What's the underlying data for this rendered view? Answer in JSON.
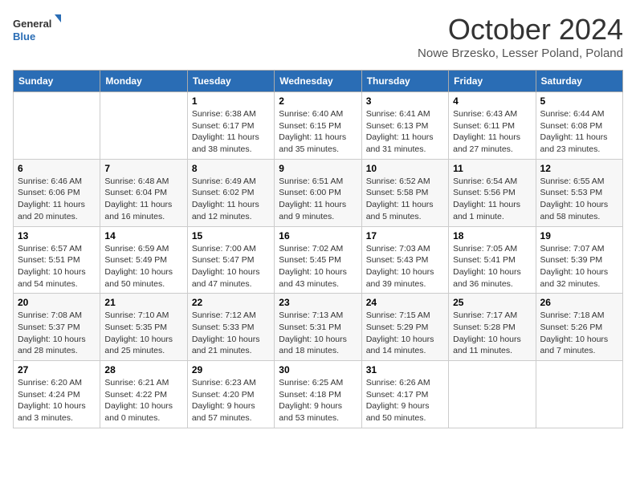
{
  "header": {
    "logo_general": "General",
    "logo_blue": "Blue",
    "month_title": "October 2024",
    "location": "Nowe Brzesko, Lesser Poland, Poland"
  },
  "weekdays": [
    "Sunday",
    "Monday",
    "Tuesday",
    "Wednesday",
    "Thursday",
    "Friday",
    "Saturday"
  ],
  "weeks": [
    [
      {
        "day": "",
        "info": ""
      },
      {
        "day": "",
        "info": ""
      },
      {
        "day": "1",
        "info": "Sunrise: 6:38 AM\nSunset: 6:17 PM\nDaylight: 11 hours and 38 minutes."
      },
      {
        "day": "2",
        "info": "Sunrise: 6:40 AM\nSunset: 6:15 PM\nDaylight: 11 hours and 35 minutes."
      },
      {
        "day": "3",
        "info": "Sunrise: 6:41 AM\nSunset: 6:13 PM\nDaylight: 11 hours and 31 minutes."
      },
      {
        "day": "4",
        "info": "Sunrise: 6:43 AM\nSunset: 6:11 PM\nDaylight: 11 hours and 27 minutes."
      },
      {
        "day": "5",
        "info": "Sunrise: 6:44 AM\nSunset: 6:08 PM\nDaylight: 11 hours and 23 minutes."
      }
    ],
    [
      {
        "day": "6",
        "info": "Sunrise: 6:46 AM\nSunset: 6:06 PM\nDaylight: 11 hours and 20 minutes."
      },
      {
        "day": "7",
        "info": "Sunrise: 6:48 AM\nSunset: 6:04 PM\nDaylight: 11 hours and 16 minutes."
      },
      {
        "day": "8",
        "info": "Sunrise: 6:49 AM\nSunset: 6:02 PM\nDaylight: 11 hours and 12 minutes."
      },
      {
        "day": "9",
        "info": "Sunrise: 6:51 AM\nSunset: 6:00 PM\nDaylight: 11 hours and 9 minutes."
      },
      {
        "day": "10",
        "info": "Sunrise: 6:52 AM\nSunset: 5:58 PM\nDaylight: 11 hours and 5 minutes."
      },
      {
        "day": "11",
        "info": "Sunrise: 6:54 AM\nSunset: 5:56 PM\nDaylight: 11 hours and 1 minute."
      },
      {
        "day": "12",
        "info": "Sunrise: 6:55 AM\nSunset: 5:53 PM\nDaylight: 10 hours and 58 minutes."
      }
    ],
    [
      {
        "day": "13",
        "info": "Sunrise: 6:57 AM\nSunset: 5:51 PM\nDaylight: 10 hours and 54 minutes."
      },
      {
        "day": "14",
        "info": "Sunrise: 6:59 AM\nSunset: 5:49 PM\nDaylight: 10 hours and 50 minutes."
      },
      {
        "day": "15",
        "info": "Sunrise: 7:00 AM\nSunset: 5:47 PM\nDaylight: 10 hours and 47 minutes."
      },
      {
        "day": "16",
        "info": "Sunrise: 7:02 AM\nSunset: 5:45 PM\nDaylight: 10 hours and 43 minutes."
      },
      {
        "day": "17",
        "info": "Sunrise: 7:03 AM\nSunset: 5:43 PM\nDaylight: 10 hours and 39 minutes."
      },
      {
        "day": "18",
        "info": "Sunrise: 7:05 AM\nSunset: 5:41 PM\nDaylight: 10 hours and 36 minutes."
      },
      {
        "day": "19",
        "info": "Sunrise: 7:07 AM\nSunset: 5:39 PM\nDaylight: 10 hours and 32 minutes."
      }
    ],
    [
      {
        "day": "20",
        "info": "Sunrise: 7:08 AM\nSunset: 5:37 PM\nDaylight: 10 hours and 28 minutes."
      },
      {
        "day": "21",
        "info": "Sunrise: 7:10 AM\nSunset: 5:35 PM\nDaylight: 10 hours and 25 minutes."
      },
      {
        "day": "22",
        "info": "Sunrise: 7:12 AM\nSunset: 5:33 PM\nDaylight: 10 hours and 21 minutes."
      },
      {
        "day": "23",
        "info": "Sunrise: 7:13 AM\nSunset: 5:31 PM\nDaylight: 10 hours and 18 minutes."
      },
      {
        "day": "24",
        "info": "Sunrise: 7:15 AM\nSunset: 5:29 PM\nDaylight: 10 hours and 14 minutes."
      },
      {
        "day": "25",
        "info": "Sunrise: 7:17 AM\nSunset: 5:28 PM\nDaylight: 10 hours and 11 minutes."
      },
      {
        "day": "26",
        "info": "Sunrise: 7:18 AM\nSunset: 5:26 PM\nDaylight: 10 hours and 7 minutes."
      }
    ],
    [
      {
        "day": "27",
        "info": "Sunrise: 6:20 AM\nSunset: 4:24 PM\nDaylight: 10 hours and 3 minutes."
      },
      {
        "day": "28",
        "info": "Sunrise: 6:21 AM\nSunset: 4:22 PM\nDaylight: 10 hours and 0 minutes."
      },
      {
        "day": "29",
        "info": "Sunrise: 6:23 AM\nSunset: 4:20 PM\nDaylight: 9 hours and 57 minutes."
      },
      {
        "day": "30",
        "info": "Sunrise: 6:25 AM\nSunset: 4:18 PM\nDaylight: 9 hours and 53 minutes."
      },
      {
        "day": "31",
        "info": "Sunrise: 6:26 AM\nSunset: 4:17 PM\nDaylight: 9 hours and 50 minutes."
      },
      {
        "day": "",
        "info": ""
      },
      {
        "day": "",
        "info": ""
      }
    ]
  ]
}
